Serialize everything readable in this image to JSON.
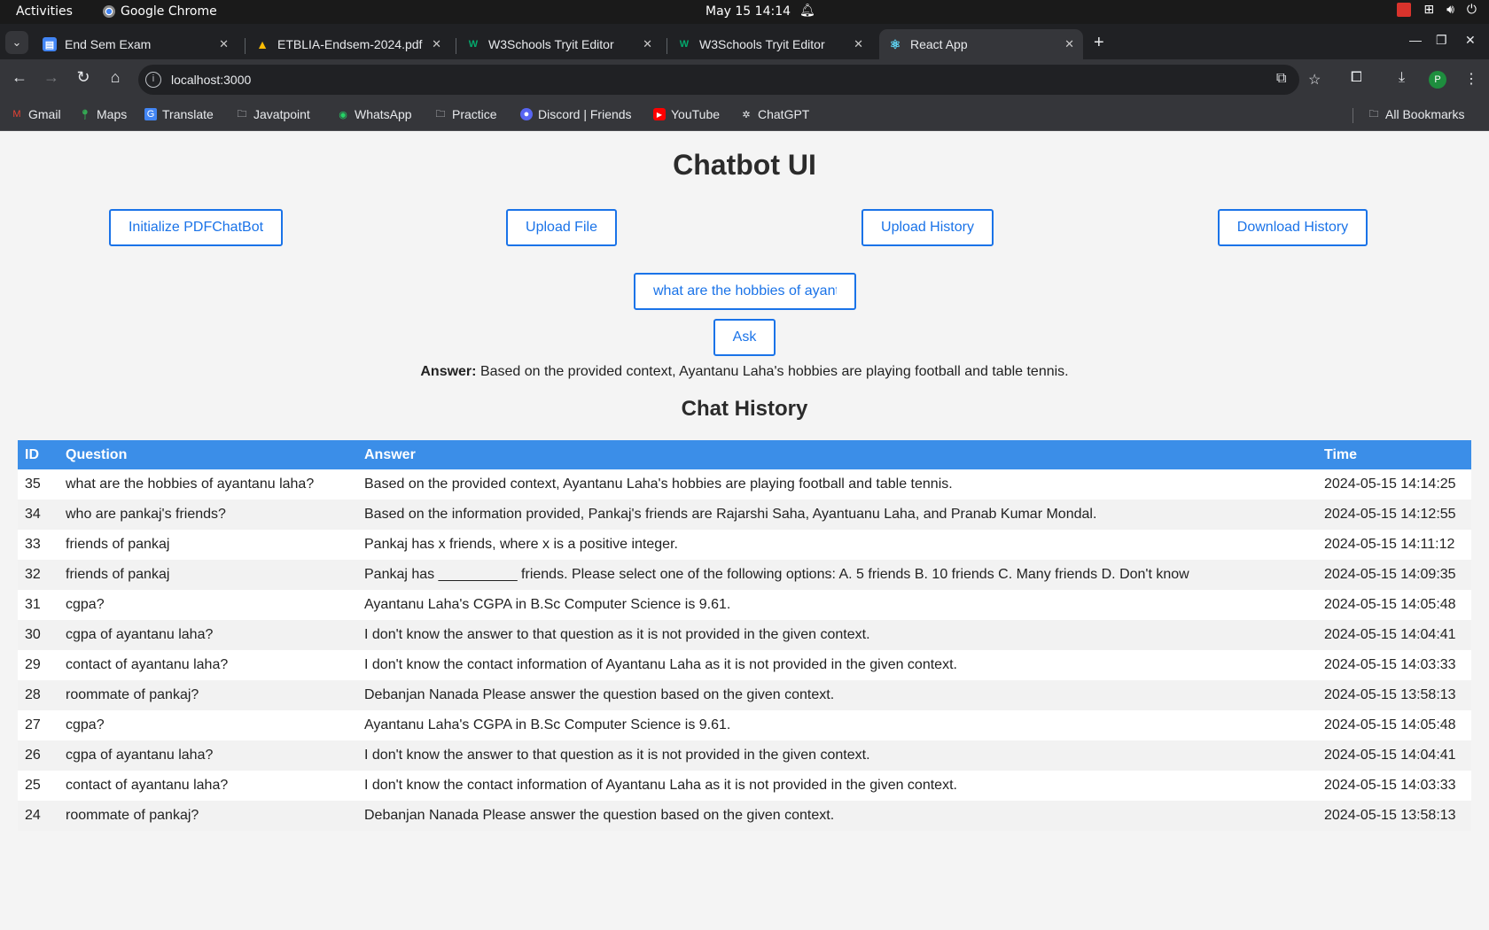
{
  "system_bar": {
    "activities": "Activities",
    "app_name": "Google Chrome",
    "clock": "May 15  14:14"
  },
  "tabs": [
    {
      "title": "End Sem Exam",
      "icon": "google-forms-icon",
      "color": "#4285f4"
    },
    {
      "title": "ETBLIA-Endsem-2024.pdf",
      "icon": "google-drive-icon",
      "color": "#fbbc04"
    },
    {
      "title": "W3Schools Tryit Editor",
      "icon": "w3schools-icon",
      "color": "#04aa6d"
    },
    {
      "title": "W3Schools Tryit Editor",
      "icon": "w3schools-icon",
      "color": "#04aa6d"
    },
    {
      "title": "React App",
      "icon": "react-icon",
      "color": "#61dafb"
    }
  ],
  "address_bar": {
    "url": "localhost:3000"
  },
  "bookmarks": [
    {
      "label": "Gmail",
      "icon": "gmail-icon"
    },
    {
      "label": "Maps",
      "icon": "maps-icon"
    },
    {
      "label": "Translate",
      "icon": "translate-icon"
    },
    {
      "label": "Javatpoint",
      "icon": "folder-icon"
    },
    {
      "label": "WhatsApp",
      "icon": "whatsapp-icon"
    },
    {
      "label": "Practice",
      "icon": "folder-icon"
    },
    {
      "label": "Discord | Friends",
      "icon": "discord-icon"
    },
    {
      "label": "YouTube",
      "icon": "youtube-icon"
    },
    {
      "label": "ChatGPT",
      "icon": "chatgpt-icon"
    },
    {
      "label": "All Bookmarks",
      "icon": "folder-icon"
    }
  ],
  "app": {
    "title": "Chatbot UI",
    "buttons": {
      "init": "Initialize PDFChatBot",
      "upload_file": "Upload File",
      "upload_history": "Upload History",
      "download_history": "Download History",
      "ask": "Ask"
    },
    "question_input": {
      "value": "what are the hobbies of ayantanu laha?"
    },
    "answer_label": "Answer:",
    "answer_text": "Based on the provided context, Ayantanu Laha's hobbies are playing football and table tennis.",
    "history_title": "Chat History",
    "history_columns": [
      "ID",
      "Question",
      "Answer",
      "Time"
    ],
    "history_rows": [
      {
        "id": "35",
        "question": "what are the hobbies of ayantanu laha?",
        "answer": "Based on the provided context, Ayantanu Laha's hobbies are playing football and table tennis.",
        "time": "2024-05-15 14:14:25"
      },
      {
        "id": "34",
        "question": "who are pankaj's friends?",
        "answer": "Based on the information provided, Pankaj's friends are Rajarshi Saha, Ayantuanu Laha, and Pranab Kumar Mondal.",
        "time": "2024-05-15 14:12:55"
      },
      {
        "id": "33",
        "question": "friends of pankaj",
        "answer": "Pankaj has x friends, where x is a positive integer.",
        "time": "2024-05-15 14:11:12"
      },
      {
        "id": "32",
        "question": "friends of pankaj",
        "answer": "Pankaj has __________ friends. Please select one of the following options: A. 5 friends B. 10 friends C. Many friends D. Don't know",
        "time": "2024-05-15 14:09:35"
      },
      {
        "id": "31",
        "question": "cgpa?",
        "answer": "Ayantanu Laha's CGPA in B.Sc Computer Science is 9.61.",
        "time": "2024-05-15 14:05:48"
      },
      {
        "id": "30",
        "question": "cgpa of ayantanu laha?",
        "answer": "I don't know the answer to that question as it is not provided in the given context.",
        "time": "2024-05-15 14:04:41"
      },
      {
        "id": "29",
        "question": "contact of ayantanu laha?",
        "answer": "I don't know the contact information of Ayantanu Laha as it is not provided in the given context.",
        "time": "2024-05-15 14:03:33"
      },
      {
        "id": "28",
        "question": "roommate of pankaj?",
        "answer": "Debanjan Nanada Please answer the question based on the given context.",
        "time": "2024-05-15 13:58:13"
      },
      {
        "id": "27",
        "question": "cgpa?",
        "answer": "Ayantanu Laha's CGPA in B.Sc Computer Science is 9.61.",
        "time": "2024-05-15 14:05:48"
      },
      {
        "id": "26",
        "question": "cgpa of ayantanu laha?",
        "answer": "I don't know the answer to that question as it is not provided in the given context.",
        "time": "2024-05-15 14:04:41"
      },
      {
        "id": "25",
        "question": "contact of ayantanu laha?",
        "answer": "I don't know the contact information of Ayantanu Laha as it is not provided in the given context.",
        "time": "2024-05-15 14:03:33"
      },
      {
        "id": "24",
        "question": "roommate of pankaj?",
        "answer": "Debanjan Nanada Please answer the question based on the given context.",
        "time": "2024-05-15 13:58:13"
      }
    ]
  },
  "colors": {
    "accent": "#1a73e8",
    "table_header": "#3b8ee8"
  }
}
